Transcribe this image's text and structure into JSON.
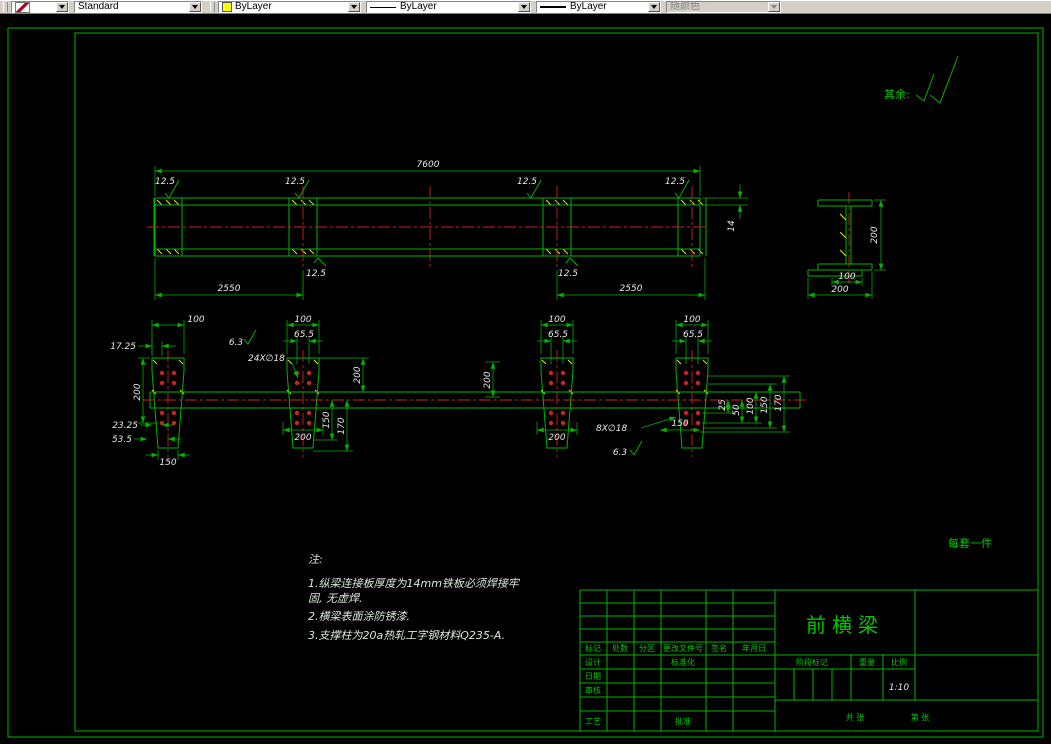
{
  "toolbar": {
    "style_value": "Standard",
    "color_value": "ByLayer",
    "linetype_value": "ByLayer",
    "lineweight_value": "ByLayer",
    "plotstyle_value": "随颜色"
  },
  "drawing": {
    "surface_note": "其余:",
    "per_set_note": "每套一件",
    "colors": {
      "line": "#00b400",
      "centerline": "#cc2222",
      "hatch": "#e8e800",
      "dim_text": "#e8e8e8"
    },
    "dims": {
      "total_length": "7600",
      "roughness": "12.5",
      "roughness_fine": "6.3",
      "span": "2550",
      "plate_thickness": "14",
      "section_height": "200",
      "section_inner": "100",
      "section_width": "200",
      "plate_top": "100",
      "hole_spacing": "65.5",
      "edge_offset": "17.25",
      "holes_24": "24X∅18",
      "holes_8": "8X∅18",
      "v200": "200",
      "d2325": "23.25",
      "d535": "53.5",
      "d150": "150",
      "d170": "170",
      "d100": "100",
      "d25": "25",
      "d50": "50",
      "d200": "200"
    },
    "notes": {
      "heading": "注:",
      "line1": "1.纵梁连接板厚度为14mm铁板必须焊接牢",
      "line2": "固, 无虚焊.",
      "line3": "2.横梁表面涂防锈漆.",
      "line4": "3.支撑柱为20a热轧工字钢材料Q235-A."
    },
    "title_block": {
      "title": "前横梁",
      "rev": [
        "标记",
        "处数",
        "分区",
        "更改文件号",
        "签名",
        "年月日"
      ],
      "design": "设计",
      "standard": "标准化",
      "date": "日期",
      "check": "审核",
      "process": "工艺",
      "approve": "批准",
      "stage": "阶段标记",
      "weight": "重量",
      "scale": "比例",
      "scale_value": "1:10",
      "sheets": "共  张",
      "sheet": "第  张"
    }
  }
}
